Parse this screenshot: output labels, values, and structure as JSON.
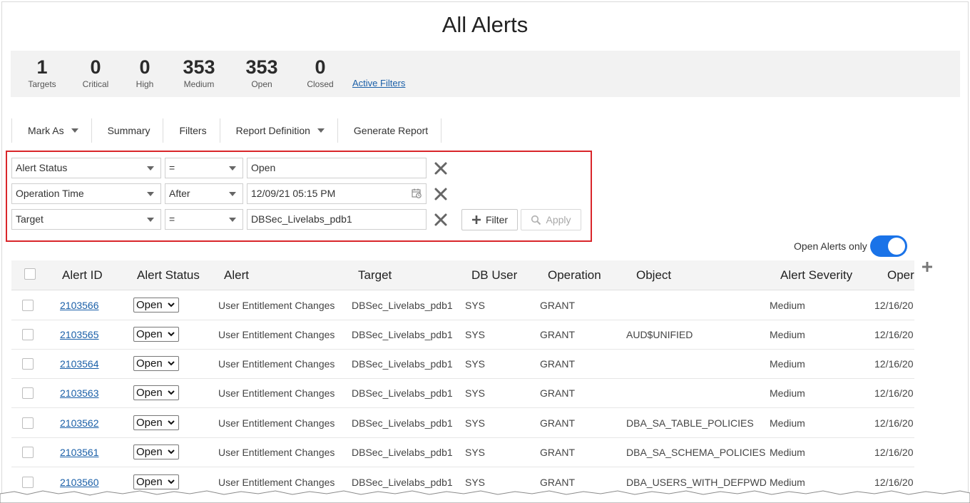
{
  "page": {
    "title": "All Alerts"
  },
  "stats": [
    {
      "value": "1",
      "label": "Targets"
    },
    {
      "value": "0",
      "label": "Critical"
    },
    {
      "value": "0",
      "label": "High"
    },
    {
      "value": "353",
      "label": "Medium"
    },
    {
      "value": "353",
      "label": "Open"
    },
    {
      "value": "0",
      "label": "Closed"
    }
  ],
  "active_filters_link": "Active Filters",
  "toolbar": {
    "mark_as": "Mark As",
    "summary": "Summary",
    "filters": "Filters",
    "report_definition": "Report Definition",
    "generate_report": "Generate Report"
  },
  "filters": [
    {
      "field": "Alert Status",
      "operator": "=",
      "value": "Open"
    },
    {
      "field": "Operation Time",
      "operator": "After",
      "value": "12/09/21 05:15 PM"
    },
    {
      "field": "Target",
      "operator": "=",
      "value": "DBSec_Livelabs_pdb1"
    }
  ],
  "filter_buttons": {
    "add": "Filter",
    "apply": "Apply"
  },
  "toggle": {
    "label": "Open Alerts only",
    "on": true
  },
  "icons": [
    "calendar-icon",
    "close-icon",
    "plus-icon",
    "search-icon",
    "chevron-down-icon",
    "add-column-icon"
  ],
  "colors": {
    "accent": "#1a73e8",
    "highlight_border": "#d9262a",
    "link": "#1a5fa8"
  },
  "table": {
    "columns": [
      "Alert ID",
      "Alert Status",
      "Alert",
      "Target",
      "DB User",
      "Operation",
      "Object",
      "Alert Severity",
      "Oper"
    ],
    "rows": [
      {
        "id": "2103566",
        "status": "Open",
        "alert": "User Entitlement Changes",
        "target": "DBSec_Livelabs_pdb1",
        "db_user": "SYS",
        "operation": "GRANT",
        "object": "",
        "severity": "Medium",
        "op_time": "12/16/20"
      },
      {
        "id": "2103565",
        "status": "Open",
        "alert": "User Entitlement Changes",
        "target": "DBSec_Livelabs_pdb1",
        "db_user": "SYS",
        "operation": "GRANT",
        "object": "AUD$UNIFIED",
        "severity": "Medium",
        "op_time": "12/16/20"
      },
      {
        "id": "2103564",
        "status": "Open",
        "alert": "User Entitlement Changes",
        "target": "DBSec_Livelabs_pdb1",
        "db_user": "SYS",
        "operation": "GRANT",
        "object": "",
        "severity": "Medium",
        "op_time": "12/16/20"
      },
      {
        "id": "2103563",
        "status": "Open",
        "alert": "User Entitlement Changes",
        "target": "DBSec_Livelabs_pdb1",
        "db_user": "SYS",
        "operation": "GRANT",
        "object": "",
        "severity": "Medium",
        "op_time": "12/16/20"
      },
      {
        "id": "2103562",
        "status": "Open",
        "alert": "User Entitlement Changes",
        "target": "DBSec_Livelabs_pdb1",
        "db_user": "SYS",
        "operation": "GRANT",
        "object": "DBA_SA_TABLE_POLICIES",
        "severity": "Medium",
        "op_time": "12/16/20"
      },
      {
        "id": "2103561",
        "status": "Open",
        "alert": "User Entitlement Changes",
        "target": "DBSec_Livelabs_pdb1",
        "db_user": "SYS",
        "operation": "GRANT",
        "object": "DBA_SA_SCHEMA_POLICIES",
        "severity": "Medium",
        "op_time": "12/16/20"
      },
      {
        "id": "2103560",
        "status": "Open",
        "alert": "User Entitlement Changes",
        "target": "DBSec_Livelabs_pdb1",
        "db_user": "SYS",
        "operation": "GRANT",
        "object": "DBA_USERS_WITH_DEFPWD",
        "severity": "Medium",
        "op_time": "12/16/20"
      }
    ]
  }
}
